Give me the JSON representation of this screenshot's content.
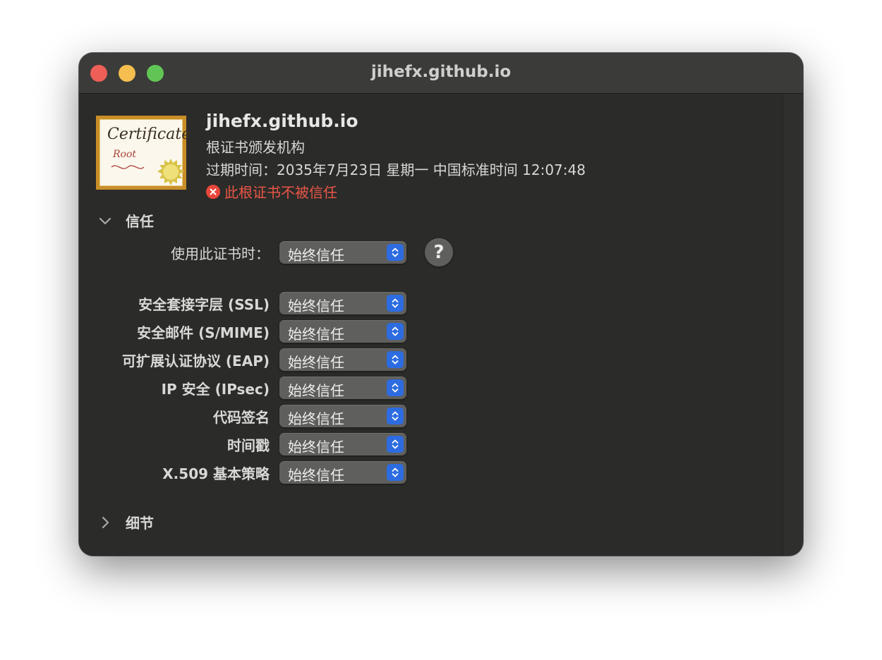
{
  "window": {
    "title": "jihefx.github.io"
  },
  "certificate": {
    "name": "jihefx.github.io",
    "kind": "根证书颁发机构",
    "expiry": "过期时间：2035年7月23日 星期一 中国标准时间 12:07:48",
    "warning": "此根证书不被信任",
    "icon_text": "Certificate",
    "icon_subtext": "Root"
  },
  "trust_section": {
    "title": "信任",
    "expanded": true,
    "when_using": {
      "label": "使用此证书时：",
      "value": "始终信任"
    },
    "help_label": "?",
    "policies": [
      {
        "label": "安全套接字层 (SSL)",
        "value": "始终信任"
      },
      {
        "label": "安全邮件 (S/MIME)",
        "value": "始终信任"
      },
      {
        "label": "可扩展认证协议 (EAP)",
        "value": "始终信任"
      },
      {
        "label": "IP 安全 (IPsec)",
        "value": "始终信任"
      },
      {
        "label": "代码签名",
        "value": "始终信任"
      },
      {
        "label": "时间戳",
        "value": "始终信任"
      },
      {
        "label": "X.509 基本策略",
        "value": "始终信任"
      }
    ]
  },
  "details_section": {
    "title": "细节",
    "expanded": false
  },
  "colors": {
    "window_bg": "#2b2b29",
    "titlebar_bg": "#3b3b39",
    "warning": "#ea5646",
    "accent": "#2d6ce0",
    "close": "#ed5f57",
    "minimize": "#f5be4f",
    "maximize": "#61c555"
  },
  "icons": {
    "warning": "x-circle-icon",
    "collapse": "chevron-down-icon",
    "expand": "chevron-right-icon",
    "popup": "up-down-chevron-icon",
    "certificate": "certificate-icon"
  }
}
